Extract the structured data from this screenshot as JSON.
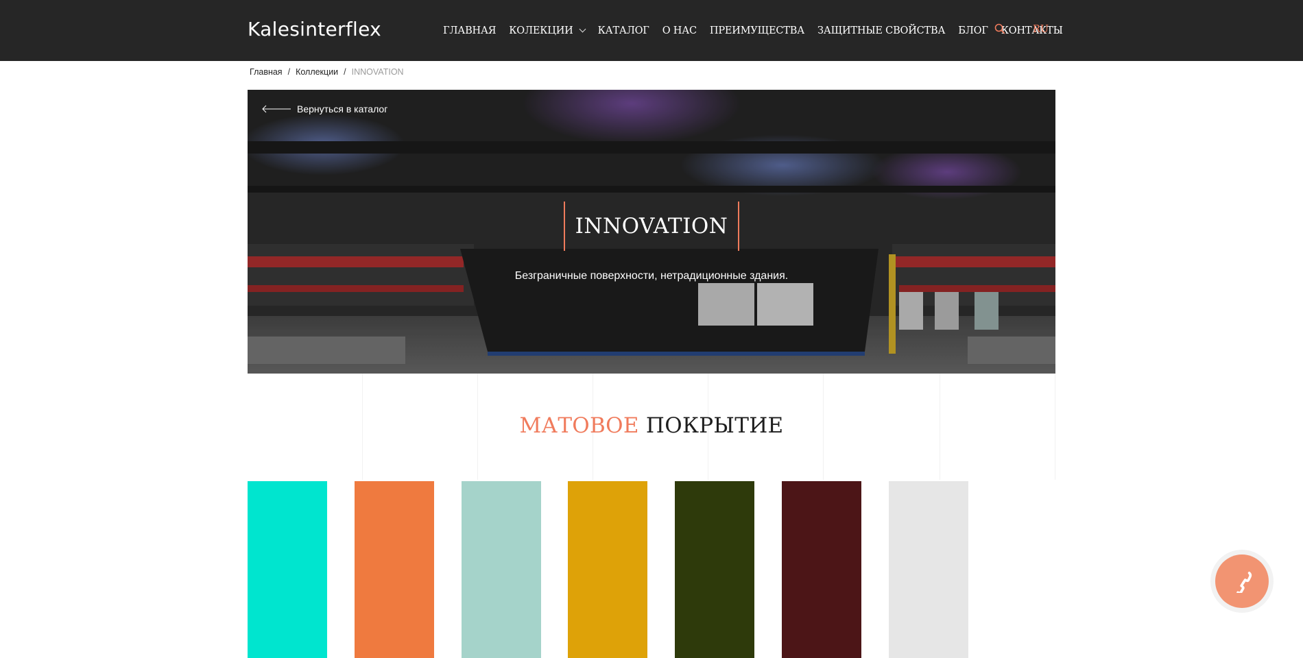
{
  "header": {
    "logo": "Kalesinterflex",
    "nav": [
      {
        "label": "ГЛАВНАЯ"
      },
      {
        "label": "КОЛЕКЦИИ",
        "dropdown": true
      },
      {
        "label": "КАТАЛОГ"
      },
      {
        "label": "О НАС"
      },
      {
        "label": "ПРЕИМУЩЕСТВА"
      },
      {
        "label": "ЗАЩИТНЫЕ СВОЙСТВА"
      },
      {
        "label": "БЛОГ"
      },
      {
        "label": "КОНТАКТЫ"
      }
    ],
    "search_icon": "search-icon",
    "language": "RU"
  },
  "breadcrumb": {
    "home": "Главная",
    "collections": "Коллекции",
    "current": "INNOVATION"
  },
  "hero": {
    "back_label": "Вернуться в каталог",
    "title": "INNOVATION",
    "subtitle": "Безграничные поверхности, нетрадиционные здания."
  },
  "section": {
    "title_accent": "МАТОВОЕ",
    "title_rest": "ПОКРЫТИЕ"
  },
  "swatches": [
    {
      "color": "#00e5cf"
    },
    {
      "color": "#ef7a3f"
    },
    {
      "color": "#a5d3ca"
    },
    {
      "color": "#dea208"
    },
    {
      "color": "#2e3a0b"
    },
    {
      "color": "#4c1517"
    },
    {
      "color": "#e6e6e6"
    }
  ],
  "colors": {
    "accent": "#f07b5c",
    "header_bg": "#262626",
    "call_button": "#f29472"
  },
  "call_button_icon": "phone-icon"
}
